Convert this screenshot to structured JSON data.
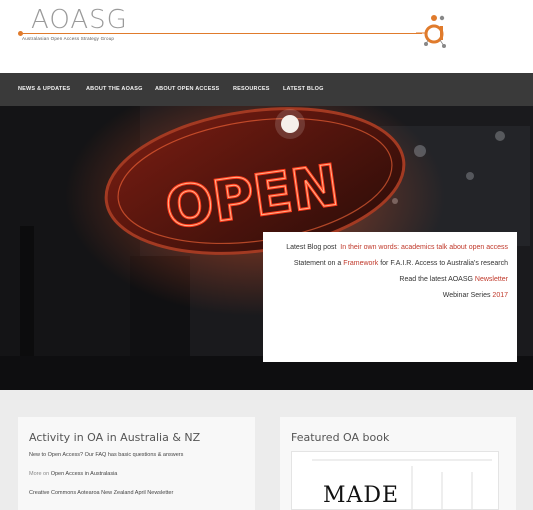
{
  "header": {
    "logo_text": "AOASG",
    "logo_subtitle": "Australasian Open Access Strategy Group",
    "accent_color": "#e07b2c"
  },
  "nav": {
    "items": [
      {
        "label": "NEWS & UPDATES"
      },
      {
        "label": "ABOUT THE AOASG"
      },
      {
        "label": "ABOUT OPEN ACCESS"
      },
      {
        "label": "RESOURCES"
      },
      {
        "label": "LATEST BLOG"
      }
    ]
  },
  "hero": {
    "sign_text": "OPEN",
    "info": {
      "blog_prefix": "Latest Blog post",
      "blog_link": "In their own words: academics talk about open access",
      "statement_prefix": "Statement on a",
      "statement_link": "Framework",
      "statement_suffix": "for F.A.I.R. Access to Australia's research",
      "newsletter_prefix": "Read the latest AOASG",
      "newsletter_link": "Newsletter",
      "webinar_prefix": "Webinar Series",
      "webinar_link": "2017"
    },
    "link_color": "#c0392b"
  },
  "activity": {
    "title": "Activity in OA in Australia & NZ",
    "items": [
      {
        "text": "New to Open Access? Our FAQ has basic questions & answers"
      },
      {
        "muted": "More on",
        "text": "Open Access in Australasia"
      },
      {
        "text": "Creative Commons Aotearoa New Zealand April Newsletter"
      }
    ]
  },
  "featured": {
    "title": "Featured OA book",
    "book_title": "MADE"
  }
}
